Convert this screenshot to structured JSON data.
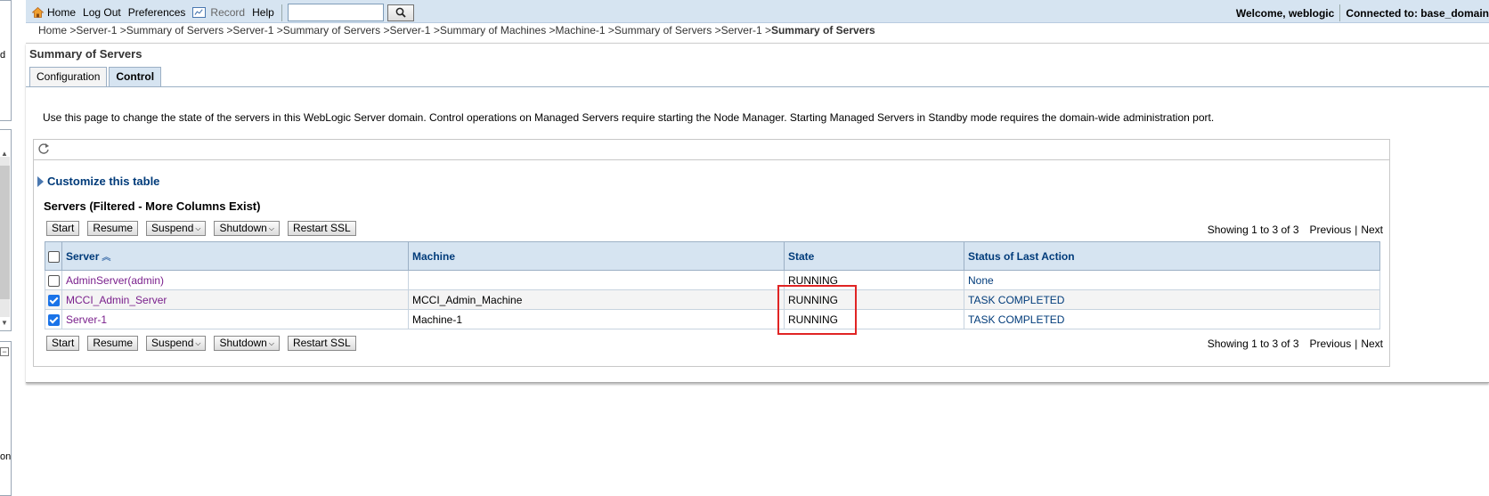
{
  "left_panel": {
    "char1": "d",
    "char2": "on"
  },
  "topbar": {
    "home": "Home",
    "logout": "Log Out",
    "preferences": "Preferences",
    "record": "Record",
    "help": "Help",
    "search_value": "",
    "welcome": "Welcome, weblogic",
    "connected": "Connected to: base_domain"
  },
  "breadcrumb": {
    "trail": "Home >Server-1 >Summary of Servers >Server-1 >Summary of Servers >Server-1 >Summary of Machines >Machine-1 >Summary of Servers >Server-1 >",
    "current": "Summary of Servers"
  },
  "page": {
    "title": "Summary of Servers",
    "tabs": [
      "Configuration",
      "Control"
    ],
    "description": "Use this page to change the state of the servers in this WebLogic Server domain. Control operations on Managed Servers require starting the Node Manager. Starting Managed Servers in Standby mode requires the domain-wide administration port."
  },
  "table": {
    "customize": "Customize this table",
    "title": "Servers (Filtered - More Columns Exist)",
    "buttons": {
      "start": "Start",
      "resume": "Resume",
      "suspend": "Suspend",
      "shutdown": "Shutdown",
      "restart_ssl": "Restart SSL"
    },
    "paging": {
      "showing": "Showing 1 to 3 of 3",
      "previous": "Previous",
      "separator": "|",
      "next": "Next"
    },
    "columns": [
      "Server",
      "Machine",
      "State",
      "Status of Last Action"
    ],
    "rows": [
      {
        "server": "AdminServer(admin)",
        "machine": "",
        "state": "RUNNING",
        "status": "None",
        "checked": false
      },
      {
        "server": "MCCI_Admin_Server",
        "machine": "MCCI_Admin_Machine",
        "state": "RUNNING",
        "status": "TASK COMPLETED",
        "checked": true
      },
      {
        "server": "Server-1",
        "machine": "Machine-1",
        "state": "RUNNING",
        "status": "TASK COMPLETED",
        "checked": true
      }
    ]
  },
  "colors": {
    "header_bg": "#d6e4f1",
    "link_blue": "#003b7a",
    "server_link": "#7a1f8c",
    "highlight": "#e02424"
  }
}
